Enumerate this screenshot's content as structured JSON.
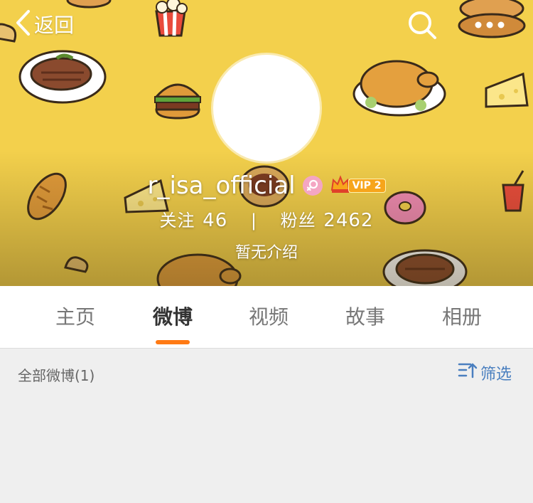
{
  "nav": {
    "back_label": "返回"
  },
  "profile": {
    "username": "r_isa_official",
    "vip_label": "VIP 2",
    "following_label": "关注",
    "following_count": "46",
    "separator": "|",
    "followers_label": "粉丝",
    "followers_count": "2462",
    "intro": "暂无介绍"
  },
  "tabs": [
    {
      "label": "主页",
      "active": false
    },
    {
      "label": "微博",
      "active": true
    },
    {
      "label": "视频",
      "active": false
    },
    {
      "label": "故事",
      "active": false
    },
    {
      "label": "相册",
      "active": false
    }
  ],
  "feed": {
    "count_label": "全部微博(1)",
    "filter_label": "筛选"
  },
  "colors": {
    "banner": "#f3d04c",
    "accent": "#ff7a14",
    "link": "#4a7fbf"
  },
  "icons": [
    "back-chevron-icon",
    "search-icon",
    "more-icon",
    "female-icon",
    "vip-crown-icon",
    "filter-sort-icon"
  ]
}
